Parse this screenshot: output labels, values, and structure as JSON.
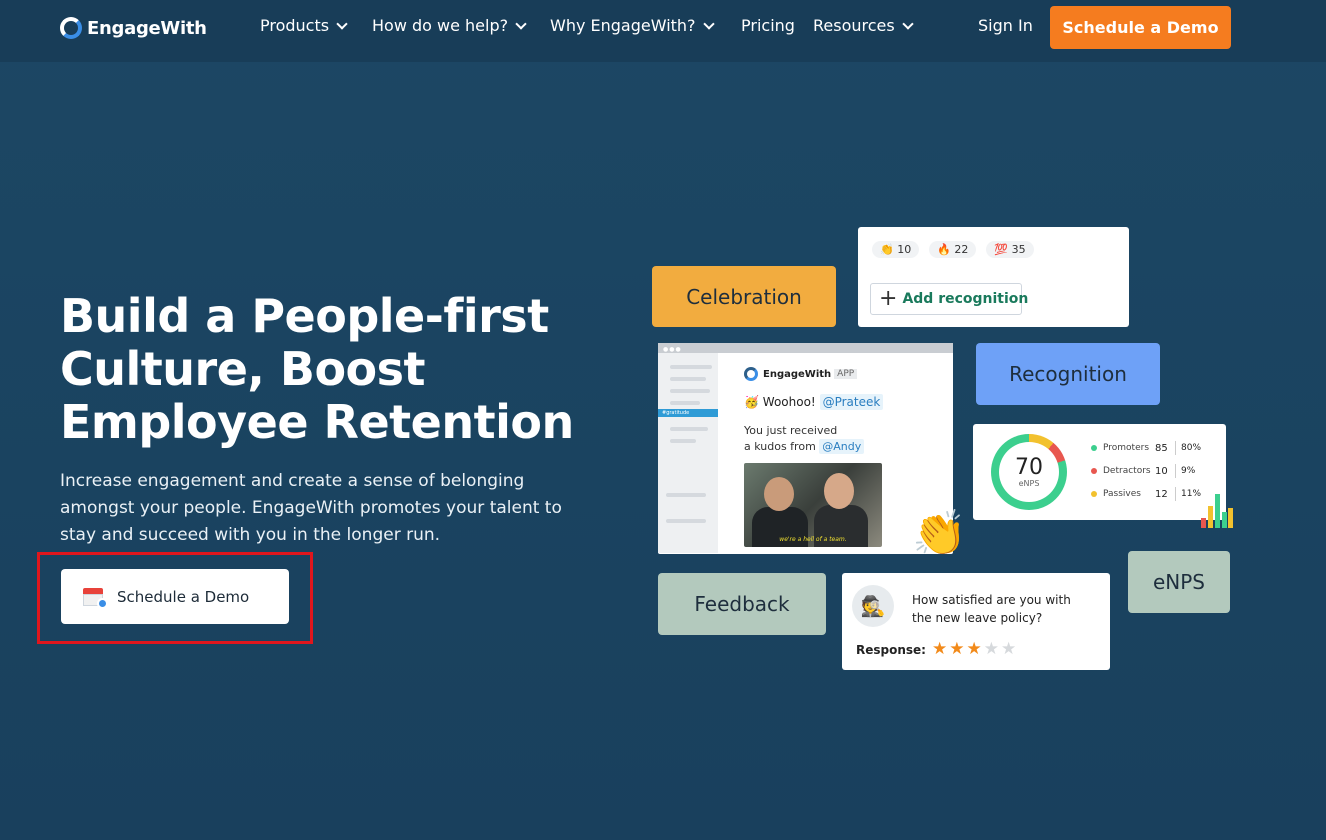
{
  "nav": {
    "brand": "EngageWith",
    "items": [
      {
        "label": "Products",
        "dropdown": true
      },
      {
        "label": "How do we help?",
        "dropdown": true
      },
      {
        "label": "Why EngageWith?",
        "dropdown": true
      },
      {
        "label": "Pricing",
        "dropdown": false
      },
      {
        "label": "Resources",
        "dropdown": true
      }
    ],
    "signin": "Sign In",
    "cta": "Schedule a Demo"
  },
  "hero": {
    "title": "Build a People-first Culture, Boost Employee Retention",
    "subtitle": "Increase engagement and create a sense of belonging amongst your people. EngageWith promotes your talent to stay and succeed with you in the longer run.",
    "cta": "Schedule a Demo"
  },
  "illustration": {
    "tags": {
      "celebration": "Celebration",
      "recognition": "Recognition",
      "feedback": "Feedback",
      "enps": "eNPS"
    },
    "reactions": [
      {
        "emoji": "👏",
        "count": "10"
      },
      {
        "emoji": "🔥",
        "count": "22"
      },
      {
        "emoji": "💯",
        "count": "35"
      }
    ],
    "add_recognition": "Add recognition",
    "message": {
      "app_name": "EngageWith",
      "app_badge": "APP",
      "side_channel": "#gratitude",
      "greeting_emoji": "🥳",
      "greeting": "Woohoo!",
      "mention_to": "@Prateek",
      "line1": "You just received",
      "line2": "a kudos from",
      "mention_from": "@Andy",
      "gif_caption": "we're a hell of a team."
    },
    "enps": {
      "score": "70",
      "label": "eNPS",
      "rows": [
        {
          "name": "Promoters",
          "count": "85",
          "pct": "80%",
          "color": "#3ccf8e"
        },
        {
          "name": "Detractors",
          "count": "10",
          "pct": "9%",
          "color": "#e8574f"
        },
        {
          "name": "Passives",
          "count": "12",
          "pct": "11%",
          "color": "#f2c12e"
        }
      ]
    },
    "survey": {
      "question": "How satisfied are you with the new leave policy?",
      "response_label": "Response:",
      "rating": 3,
      "max_rating": 5
    }
  },
  "colors": {
    "background": "#1b4663",
    "nav": "#183d58",
    "cta": "#f57c1f",
    "celebration": "#f2ac3f",
    "recognition": "#6ea1f7",
    "feedback": "#b3c9bd",
    "enps": "#b3c9bd",
    "highlight": "#e0161d"
  }
}
